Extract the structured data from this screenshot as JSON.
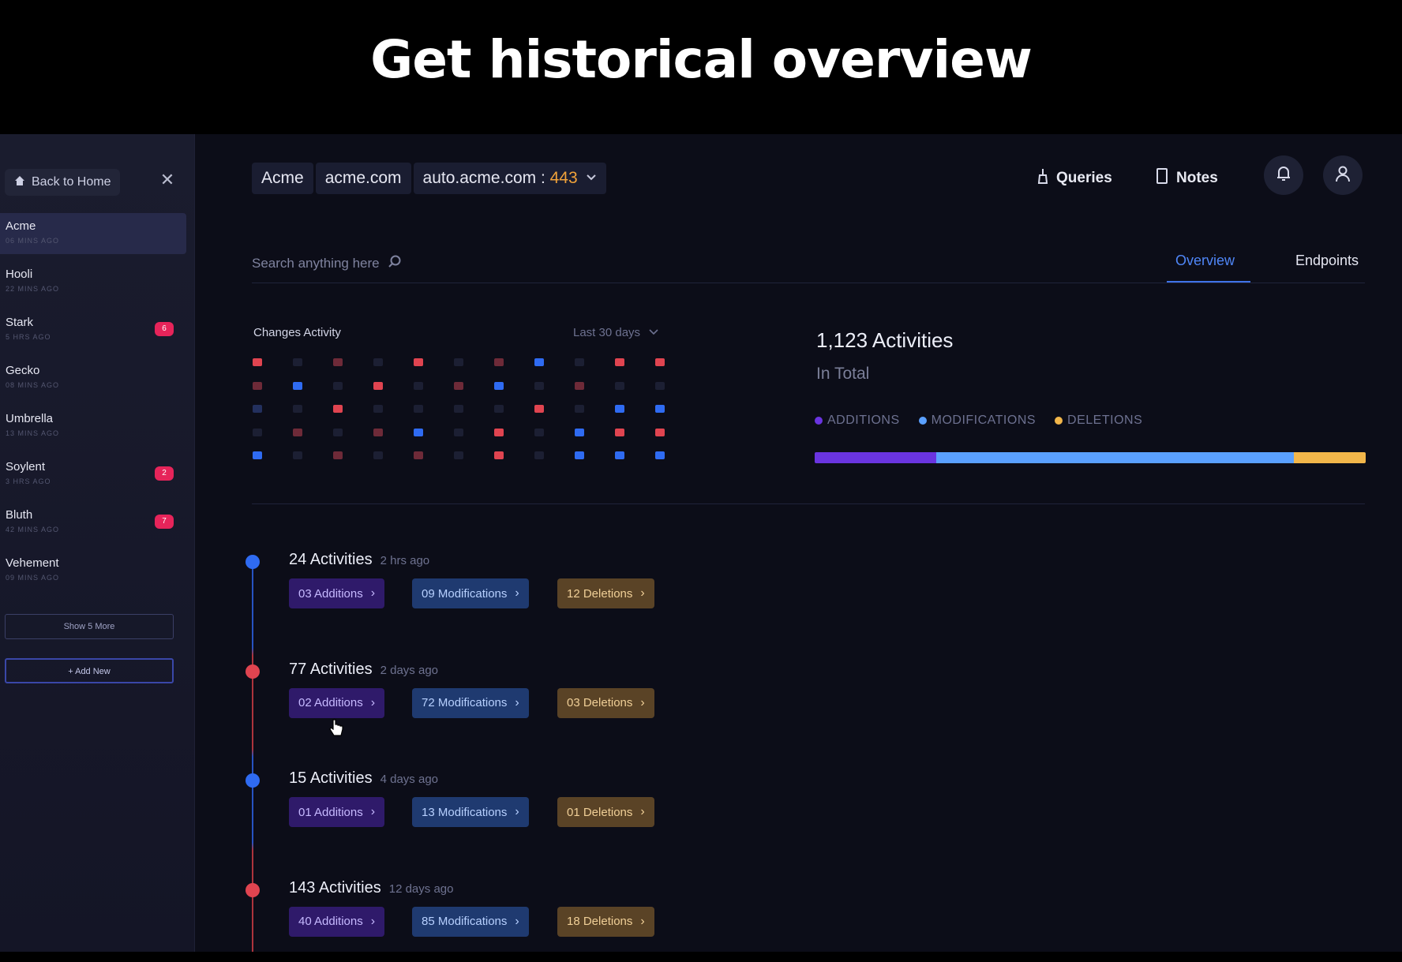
{
  "caption": "Get historical overview",
  "sidebar": {
    "back_label": "Back to Home",
    "projects": [
      {
        "name": "Acme",
        "time": "06 MINS AGO",
        "badge": ""
      },
      {
        "name": "Hooli",
        "time": "22 MINS AGO",
        "badge": ""
      },
      {
        "name": "Stark",
        "time": "5 HRS AGO",
        "badge": "6"
      },
      {
        "name": "Gecko",
        "time": "08 MINS AGO",
        "badge": ""
      },
      {
        "name": "Umbrella",
        "time": "13 MINS AGO",
        "badge": ""
      },
      {
        "name": "Soylent",
        "time": "3 HRS AGO",
        "badge": "2"
      },
      {
        "name": "Bluth",
        "time": "42 MINS AGO",
        "badge": "7"
      },
      {
        "name": "Vehement",
        "time": "09 MINS AGO",
        "badge": ""
      }
    ],
    "show_more": "Show 5 More",
    "add_new": "+ Add New"
  },
  "header": {
    "crumbs": [
      "Acme",
      "acme.com"
    ],
    "host": "auto.acme.com : ",
    "port": "443",
    "queries_label": "Queries",
    "notes_label": "Notes"
  },
  "search": {
    "placeholder": "Search anything here"
  },
  "tabs": {
    "overview": "Overview",
    "endpoints": "Endpoints"
  },
  "changes": {
    "title": "Changes Activity",
    "range": "Last 30 days",
    "colors": {
      "red": "#e04450",
      "red_dim": "#6e2a38",
      "blue": "#2f6bf2",
      "blue_dim": "#23305e",
      "empty": "#1c1f33"
    },
    "grid": [
      [
        "red",
        "empty",
        "red_dim",
        "empty",
        "red",
        "empty",
        "red_dim",
        "blue",
        "empty",
        "red",
        "red"
      ],
      [
        "red_dim",
        "blue",
        "empty",
        "red",
        "empty",
        "red_dim",
        "blue",
        "empty",
        "red_dim",
        "empty",
        "empty"
      ],
      [
        "blue_dim",
        "empty",
        "red",
        "empty",
        "empty",
        "empty",
        "empty",
        "red",
        "empty",
        "blue",
        "blue"
      ],
      [
        "empty",
        "red_dim",
        "empty",
        "red_dim",
        "blue",
        "empty",
        "red",
        "empty",
        "blue",
        "red",
        "red"
      ],
      [
        "blue",
        "empty",
        "red_dim",
        "empty",
        "red_dim",
        "empty",
        "red",
        "empty",
        "blue",
        "blue",
        "blue"
      ]
    ]
  },
  "totals": {
    "count": "1,123 Activities",
    "sub": "In Total",
    "legend": [
      {
        "label": "ADDITIONS",
        "color": "#6a34e0"
      },
      {
        "label": "MODIFICATIONS",
        "color": "#5aa0ff"
      },
      {
        "label": "DELETIONS",
        "color": "#f2b64a"
      }
    ],
    "bar_fractions": [
      0.22,
      0.65,
      0.13
    ]
  },
  "timeline": [
    {
      "title": "24 Activities",
      "ago": "2 hrs ago",
      "node": "#2f6bf2",
      "additions": "03 Additions",
      "modifications": "09 Modifications",
      "deletions": "12 Deletions"
    },
    {
      "title": "77 Activities",
      "ago": "2 days ago",
      "node": "#e04450",
      "additions": "02 Additions",
      "modifications": "72 Modifications",
      "deletions": "03 Deletions"
    },
    {
      "title": "15 Activities",
      "ago": "4 days ago",
      "node": "#2f6bf2",
      "additions": "01 Additions",
      "modifications": "13 Modifications",
      "deletions": "01 Deletions"
    },
    {
      "title": "143 Activities",
      "ago": "12 days ago",
      "node": "#e04450",
      "additions": "40 Additions",
      "modifications": "85 Modifications",
      "deletions": "18 Deletions"
    }
  ]
}
